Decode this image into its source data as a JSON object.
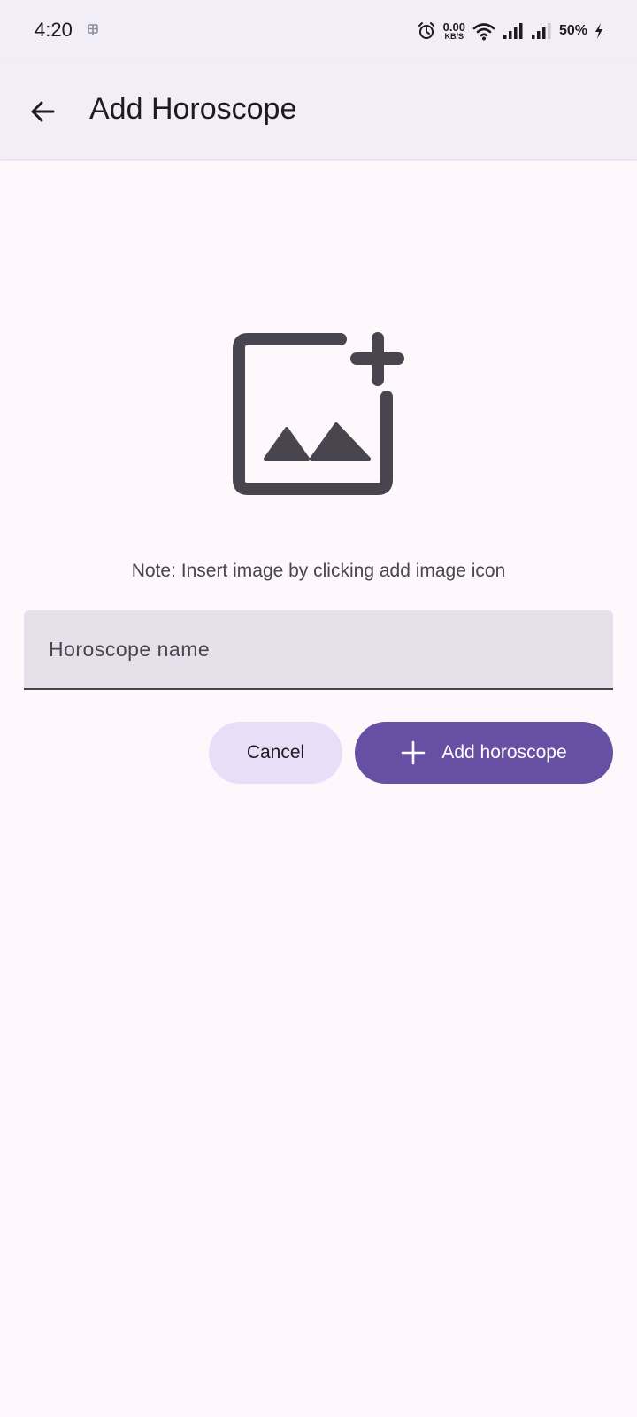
{
  "status_bar": {
    "time": "4:20",
    "net_speed_value": "0.00",
    "net_speed_unit": "KB/S",
    "battery": "50%"
  },
  "app_bar": {
    "title": "Add Horoscope",
    "back_icon": "arrow-back-icon"
  },
  "content": {
    "add_image_icon": "add-photo-icon",
    "note": "Note: Insert image by clicking add image icon",
    "name_field": {
      "placeholder": "Horoscope name",
      "value": ""
    }
  },
  "actions": {
    "cancel_label": "Cancel",
    "add_label": "Add horoscope",
    "add_icon": "plus-icon"
  },
  "colors": {
    "background": "#fef8fc",
    "bar": "#f2eef7",
    "primary": "#6750a4",
    "secondary_container": "#e8def8",
    "field_fill": "#e6e0eb",
    "icon": "#49454f"
  }
}
